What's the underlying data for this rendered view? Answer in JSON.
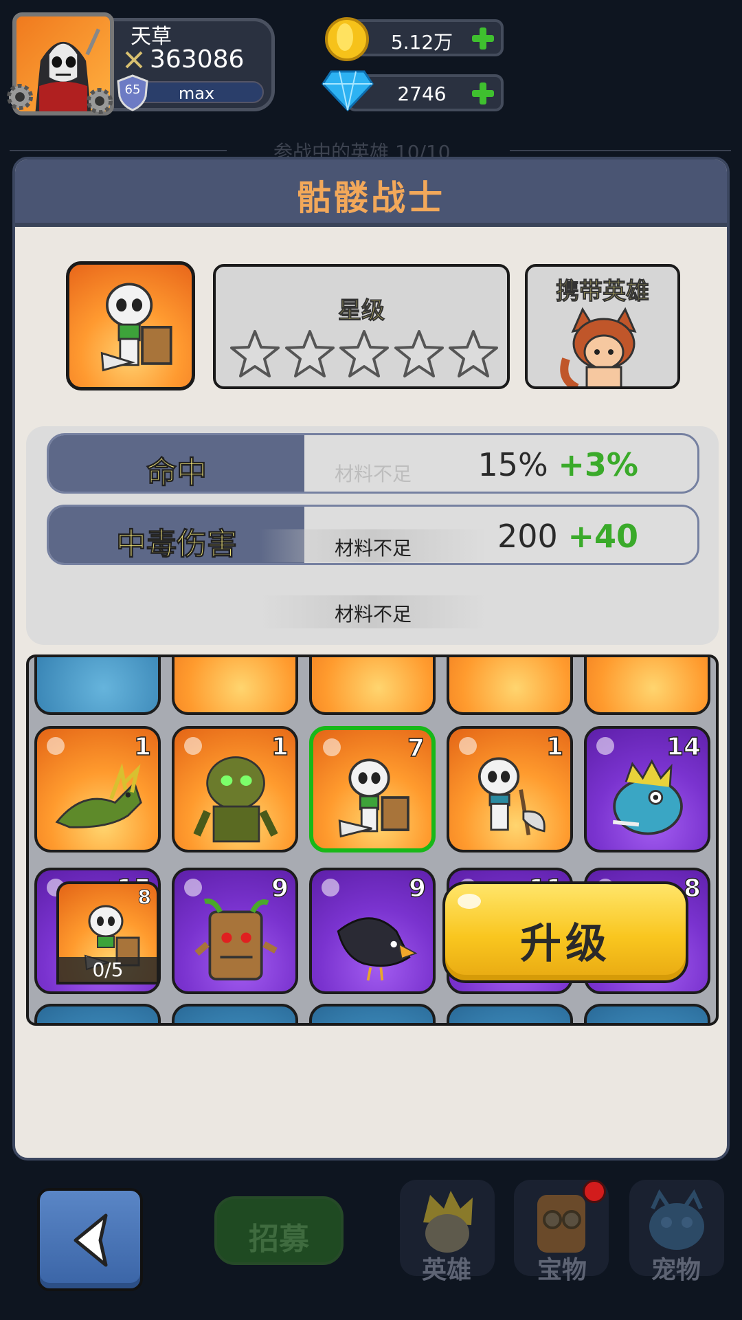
{
  "player": {
    "name": "天草",
    "power": "363086",
    "level": "65",
    "level_bar": "max"
  },
  "resources": {
    "gold": "5.12万",
    "gems": "2746"
  },
  "faded_heading": "参战中的英雄   10/10",
  "panel": {
    "title": "骷髅战士",
    "star_title": "星级",
    "stars_filled": 0,
    "stars_total": 5,
    "carry_title": "携带英雄"
  },
  "stats": [
    {
      "label": "命中",
      "base": "15%",
      "bonus": "+3%"
    },
    {
      "label": "中毒伤害",
      "base": "200",
      "bonus": "+40"
    }
  ],
  "toasts": [
    "材料不足",
    "材料不足",
    "材料不足"
  ],
  "grid": {
    "row1": [
      {
        "count": "1",
        "color": "orange",
        "icon": "dragon"
      },
      {
        "count": "1",
        "color": "orange",
        "icon": "treant-zombie"
      },
      {
        "count": "7",
        "color": "orange",
        "icon": "skeleton-warrior",
        "selected": true
      },
      {
        "count": "1",
        "color": "orange",
        "icon": "skeleton-axe"
      },
      {
        "count": "14",
        "color": "purple",
        "icon": "fish-monster"
      }
    ],
    "row2": [
      {
        "count": "15",
        "color": "purple",
        "icon": "scorpion"
      },
      {
        "count": "9",
        "color": "purple",
        "icon": "tree-stump"
      },
      {
        "count": "9",
        "color": "purple",
        "icon": "crow"
      },
      {
        "count": "11",
        "color": "purple",
        "icon": "rat"
      },
      {
        "count": "8",
        "color": "purple",
        "icon": "vulture"
      }
    ]
  },
  "material": {
    "count": "8",
    "progress": "0/5"
  },
  "upgrade_label": "升级",
  "nav": {
    "recruit": "招募",
    "heroes": "英雄",
    "treasure": "宝物",
    "pets": "宠物"
  },
  "colors": {
    "accent_title": "#f2a85a",
    "stat_label": "#f5e87a",
    "bonus_green": "#3aaa2a",
    "upgrade_yellow": "#f9c61f"
  }
}
